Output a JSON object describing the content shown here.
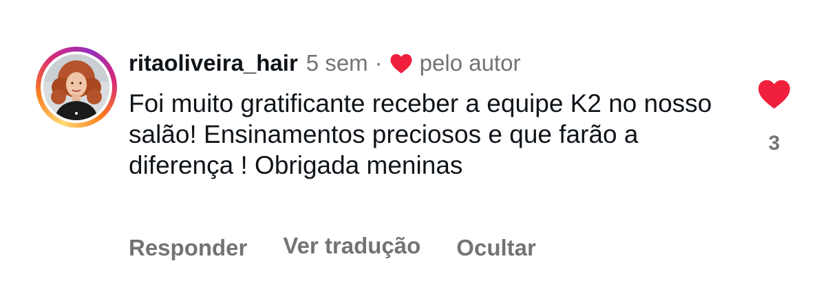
{
  "comment": {
    "username": "ritaoliveira_hair",
    "timestamp": "5 sem",
    "separator": "·",
    "liked_by_author_label": "pelo autor",
    "text": "Foi muito gratificante receber a equipe K2 no nosso salão! Ensinamentos preciosos e que farão a diferença ! Obrigada meninas",
    "like_count": "3",
    "actions": {
      "reply": "Responder",
      "translate": "Ver tradução",
      "hide": "Ocultar"
    }
  },
  "colors": {
    "heart": "#f0203c",
    "muted_text": "#737373",
    "primary_text": "#0f1419",
    "story_ring": [
      "#feda75",
      "#fa7e1e",
      "#d62976",
      "#962fbf"
    ]
  },
  "icons": {
    "author_like": "heart-filled-icon",
    "like_button": "heart-filled-icon"
  }
}
